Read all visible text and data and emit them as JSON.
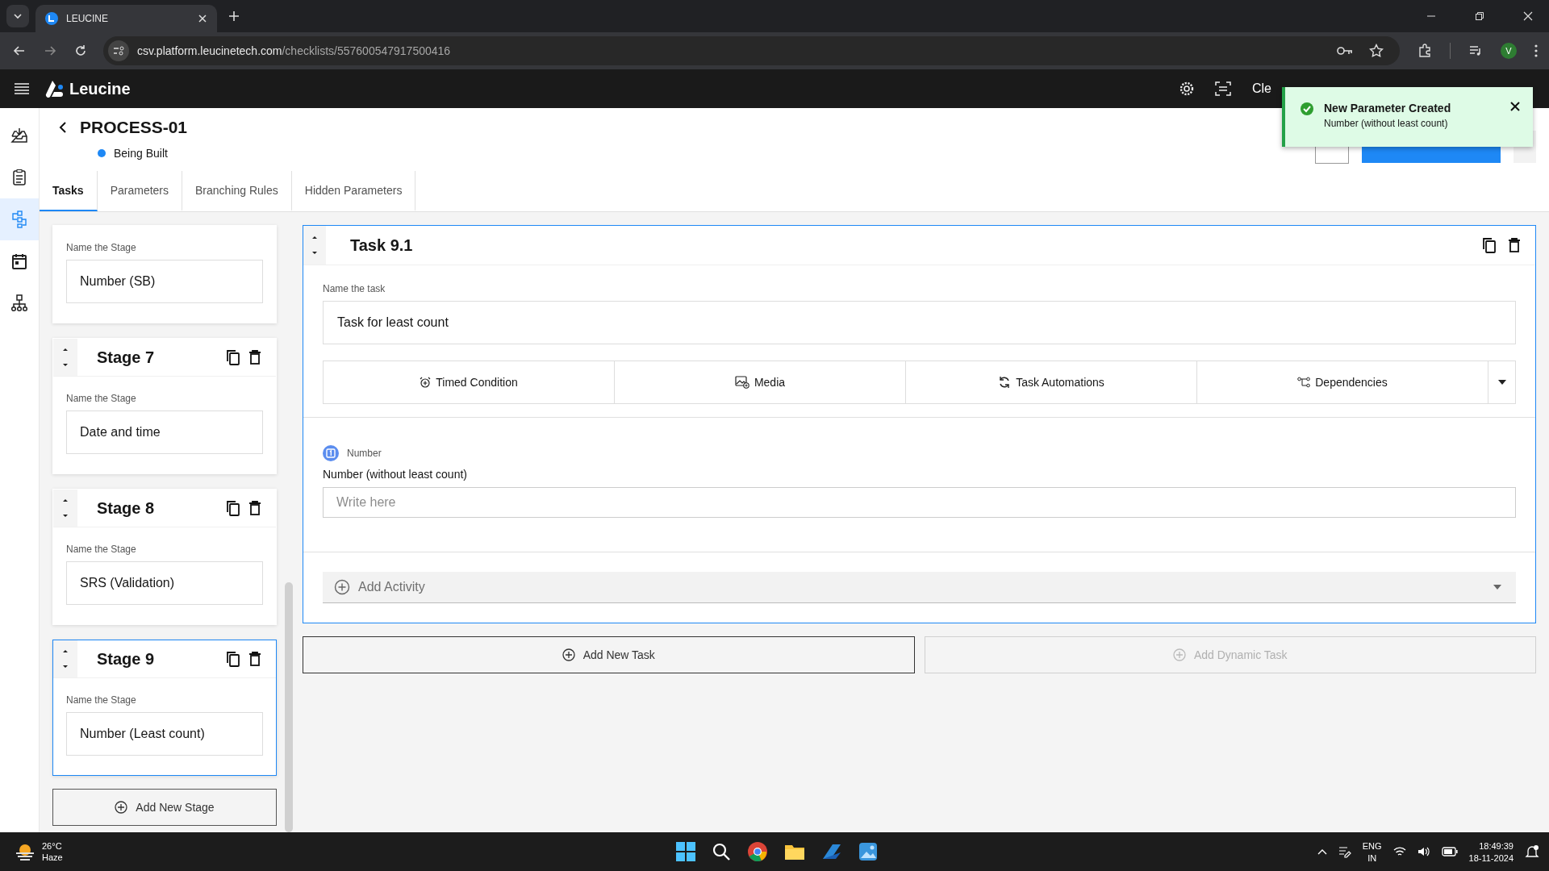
{
  "browser": {
    "tab_title": "LEUCINE",
    "url_host": "csv.platform.leucinetech.com",
    "url_path": "/checklists/557600547917500416",
    "profile": "V"
  },
  "app": {
    "logo": "Leucine",
    "header_links": [
      "Cle"
    ]
  },
  "toast": {
    "title": "New Parameter Created",
    "message": "Number (without least count)"
  },
  "rail": [
    {
      "kind": "inbox",
      "selected": false
    },
    {
      "kind": "checklist",
      "selected": false
    },
    {
      "kind": "flow",
      "selected": true
    },
    {
      "kind": "calendar",
      "selected": false
    },
    {
      "kind": "hierarchy",
      "selected": false
    }
  ],
  "process": {
    "title": "PROCESS-01",
    "status": "Being Built"
  },
  "tabs": [
    {
      "label": "Tasks",
      "selected": true
    },
    {
      "label": "Parameters",
      "selected": false
    },
    {
      "label": "Branching Rules",
      "selected": false
    },
    {
      "label": "Hidden Parameters",
      "selected": false
    }
  ],
  "stages": [
    {
      "name_label": "Name the Stage",
      "value": "Number (SB)",
      "selected": false
    },
    {
      "title": "Stage 7",
      "name_label": "Name the Stage",
      "value": "Date and time",
      "selected": false
    },
    {
      "title": "Stage 8",
      "name_label": "Name the Stage",
      "value": "SRS (Validation)",
      "selected": false
    },
    {
      "title": "Stage 9",
      "name_label": "Name the Stage",
      "value": "Number (Least count)",
      "selected": true
    }
  ],
  "add_stage": "Add New Stage",
  "task": {
    "title": "Task 9.1",
    "name_label": "Name the task",
    "name_value": "Task for least count",
    "options": [
      {
        "kind": "timer",
        "label": "Timed Condition"
      },
      {
        "kind": "media",
        "label": "Media"
      },
      {
        "kind": "automation",
        "label": "Task Automations"
      },
      {
        "kind": "dependency",
        "label": "Dependencies"
      }
    ],
    "parameter": {
      "type_label": "Number",
      "label": "Number (without least count)",
      "placeholder": "Write here"
    },
    "add_activity": "Add Activity"
  },
  "task_buttons": [
    {
      "label": "Add New Task",
      "disabled": false
    },
    {
      "label": "Add Dynamic Task",
      "disabled": true
    }
  ],
  "taskbar": {
    "temperature": "26°C",
    "condition": "Haze",
    "lang": "ENG",
    "region": "IN",
    "time": "18:49:39",
    "date": "18-11-2024"
  }
}
